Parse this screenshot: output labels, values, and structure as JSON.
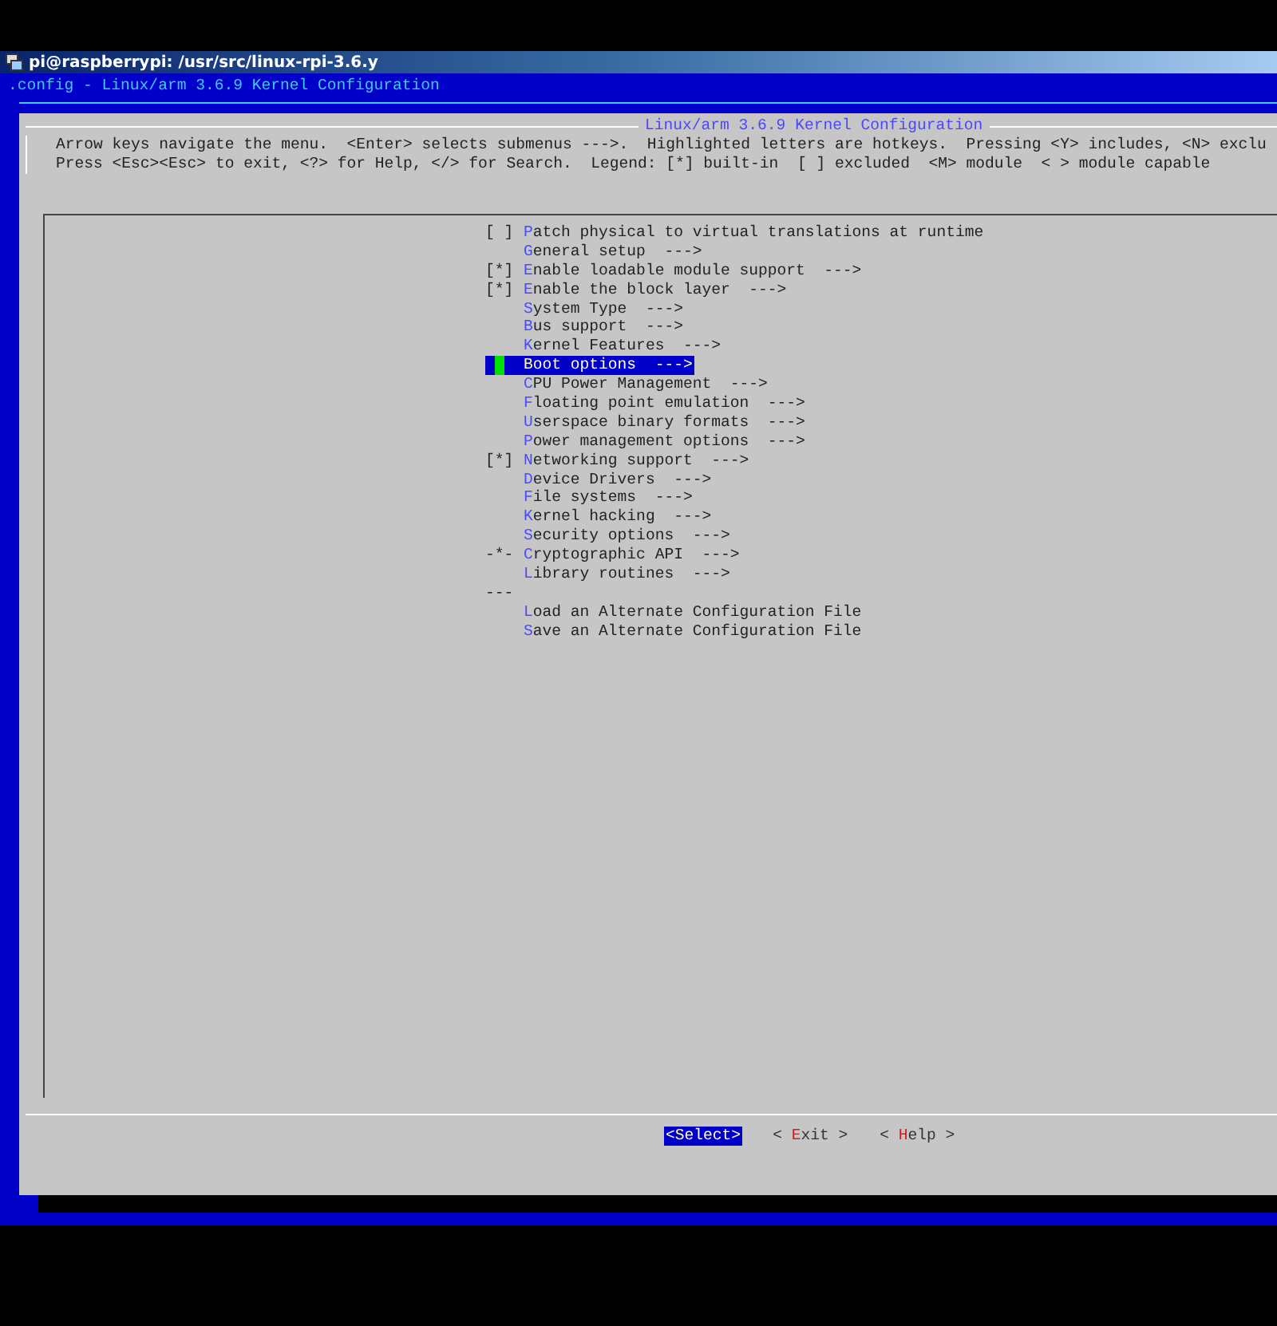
{
  "window": {
    "title": "pi@raspberrypi: /usr/src/linux-rpi-3.6.y"
  },
  "header": ".config - Linux/arm 3.6.9 Kernel Configuration",
  "dialog": {
    "title": "Linux/arm 3.6.9 Kernel Configuration",
    "help_lines": [
      "Arrow keys navigate the menu.  <Enter> selects submenus --->.  Highlighted letters are hotkeys.  Pressing <Y> includes, <N> exclu",
      "Press <Esc><Esc> to exit, <?> for Help, </> for Search.  Legend: [*] built-in  [ ] excluded  <M> module  < > module capable"
    ]
  },
  "menu": [
    {
      "kind": "item",
      "prefix": "[ ]",
      "hotkey": "P",
      "rest": "atch physical to virtual translations at runtime",
      "selected": false
    },
    {
      "kind": "item",
      "hotkey": "G",
      "rest": "eneral setup  --->",
      "selected": false
    },
    {
      "kind": "item",
      "prefix": "[*]",
      "hotkey": "E",
      "rest": "nable loadable module support  --->",
      "selected": false
    },
    {
      "kind": "item",
      "prefix": "[*]",
      "hotkey": "E",
      "rest": "nable the block layer  --->",
      "selected": false
    },
    {
      "kind": "item",
      "hotkey": "S",
      "rest": "ystem Type  --->",
      "selected": false
    },
    {
      "kind": "item",
      "hotkey": "B",
      "rest": "us support  --->",
      "selected": false
    },
    {
      "kind": "item",
      "hotkey": "K",
      "rest": "ernel Features  --->",
      "selected": false
    },
    {
      "kind": "item",
      "hotkey": "B",
      "rest": "oot options  --->",
      "selected": true
    },
    {
      "kind": "item",
      "hotkey": "C",
      "rest": "PU Power Management  --->",
      "selected": false
    },
    {
      "kind": "item",
      "hotkey": "F",
      "rest": "loating point emulation  --->",
      "selected": false
    },
    {
      "kind": "item",
      "hotkey": "U",
      "rest": "serspace binary formats  --->",
      "selected": false
    },
    {
      "kind": "item",
      "hotkey": "P",
      "rest": "ower management options  --->",
      "selected": false
    },
    {
      "kind": "item",
      "prefix": "[*]",
      "hotkey": "N",
      "rest": "etworking support  --->",
      "selected": false
    },
    {
      "kind": "item",
      "hotkey": "D",
      "rest": "evice Drivers  --->",
      "selected": false
    },
    {
      "kind": "item",
      "hotkey": "F",
      "rest": "ile systems  --->",
      "selected": false
    },
    {
      "kind": "item",
      "hotkey": "K",
      "rest": "ernel hacking  --->",
      "selected": false
    },
    {
      "kind": "item",
      "hotkey": "S",
      "rest": "ecurity options  --->",
      "selected": false
    },
    {
      "kind": "item",
      "prefix": "-*-",
      "hotkey": "C",
      "rest": "ryptographic API  --->",
      "selected": false
    },
    {
      "kind": "item",
      "hotkey": "L",
      "rest": "ibrary routines  --->",
      "selected": false
    },
    {
      "kind": "separator",
      "prefix": "---"
    },
    {
      "kind": "item",
      "hotkey": "L",
      "rest": "oad an Alternate Configuration File",
      "selected": false
    },
    {
      "kind": "item",
      "hotkey": "S",
      "rest": "ave an Alternate Configuration File",
      "selected": false
    }
  ],
  "buttons": [
    {
      "open": "<",
      "hotkey": "S",
      "rest": "elect>",
      "selected": true
    },
    {
      "open": "< ",
      "hotkey": "E",
      "rest": "xit >",
      "selected": false
    },
    {
      "open": "< ",
      "hotkey": "H",
      "rest": "elp >",
      "selected": false
    }
  ]
}
